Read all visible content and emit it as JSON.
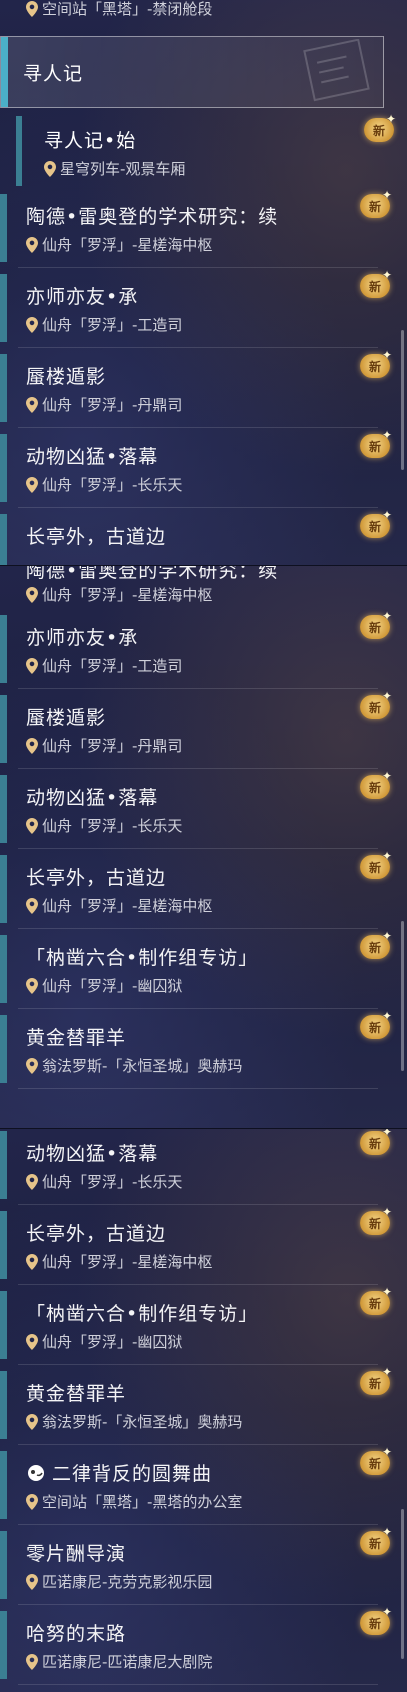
{
  "badge_text": "新",
  "p1": {
    "top_loc": "空间站「黑塔」-禁闭舱段",
    "header": "寻人记",
    "sub": {
      "title": "寻人记•始",
      "loc": "星穹列车-观景车厢"
    },
    "rows": [
      {
        "title": "陶德•雷奥登的学术研究：续",
        "loc": "仙舟「罗浮」-星槎海中枢"
      },
      {
        "title": "亦师亦友•承",
        "loc": "仙舟「罗浮」-工造司"
      },
      {
        "title": "蜃楼遁影",
        "loc": "仙舟「罗浮」-丹鼎司"
      },
      {
        "title": "动物凶猛•落幕",
        "loc": "仙舟「罗浮」-长乐天"
      },
      {
        "title": "长亭外，古道边",
        "loc": ""
      }
    ]
  },
  "p2": {
    "top_title": "陶德•雷奥登的学术研究：续",
    "top_loc": "仙舟「罗浮」-星槎海中枢",
    "rows": [
      {
        "title": "亦师亦友•承",
        "loc": "仙舟「罗浮」-工造司"
      },
      {
        "title": "蜃楼遁影",
        "loc": "仙舟「罗浮」-丹鼎司"
      },
      {
        "title": "动物凶猛•落幕",
        "loc": "仙舟「罗浮」-长乐天"
      },
      {
        "title": "长亭外，古道边",
        "loc": "仙舟「罗浮」-星槎海中枢"
      },
      {
        "title": "「枘凿六合•制作组专访」",
        "loc": "仙舟「罗浮」-幽囚狱"
      },
      {
        "title": "黄金替罪羊",
        "loc": "翁法罗斯-「永恒圣城」奥赫玛"
      }
    ]
  },
  "p3": {
    "rows": [
      {
        "title": "动物凶猛•落幕",
        "loc": "仙舟「罗浮」-长乐天"
      },
      {
        "title": "长亭外，古道边",
        "loc": "仙舟「罗浮」-星槎海中枢"
      },
      {
        "title": "「枘凿六合•制作组专访」",
        "loc": "仙舟「罗浮」-幽囚狱"
      },
      {
        "title": "黄金替罪羊",
        "loc": "翁法罗斯-「永恒圣城」奥赫玛"
      },
      {
        "title": "二律背反的圆舞曲",
        "loc": "空间站「黑塔」-黑塔的办公室",
        "icon": "herta-icon"
      },
      {
        "title": "零片酬导演",
        "loc": "匹诺康尼-克劳克影视乐园"
      },
      {
        "title": "哈努的末路",
        "loc": "匹诺康尼-匹诺康尼大剧院"
      }
    ]
  }
}
